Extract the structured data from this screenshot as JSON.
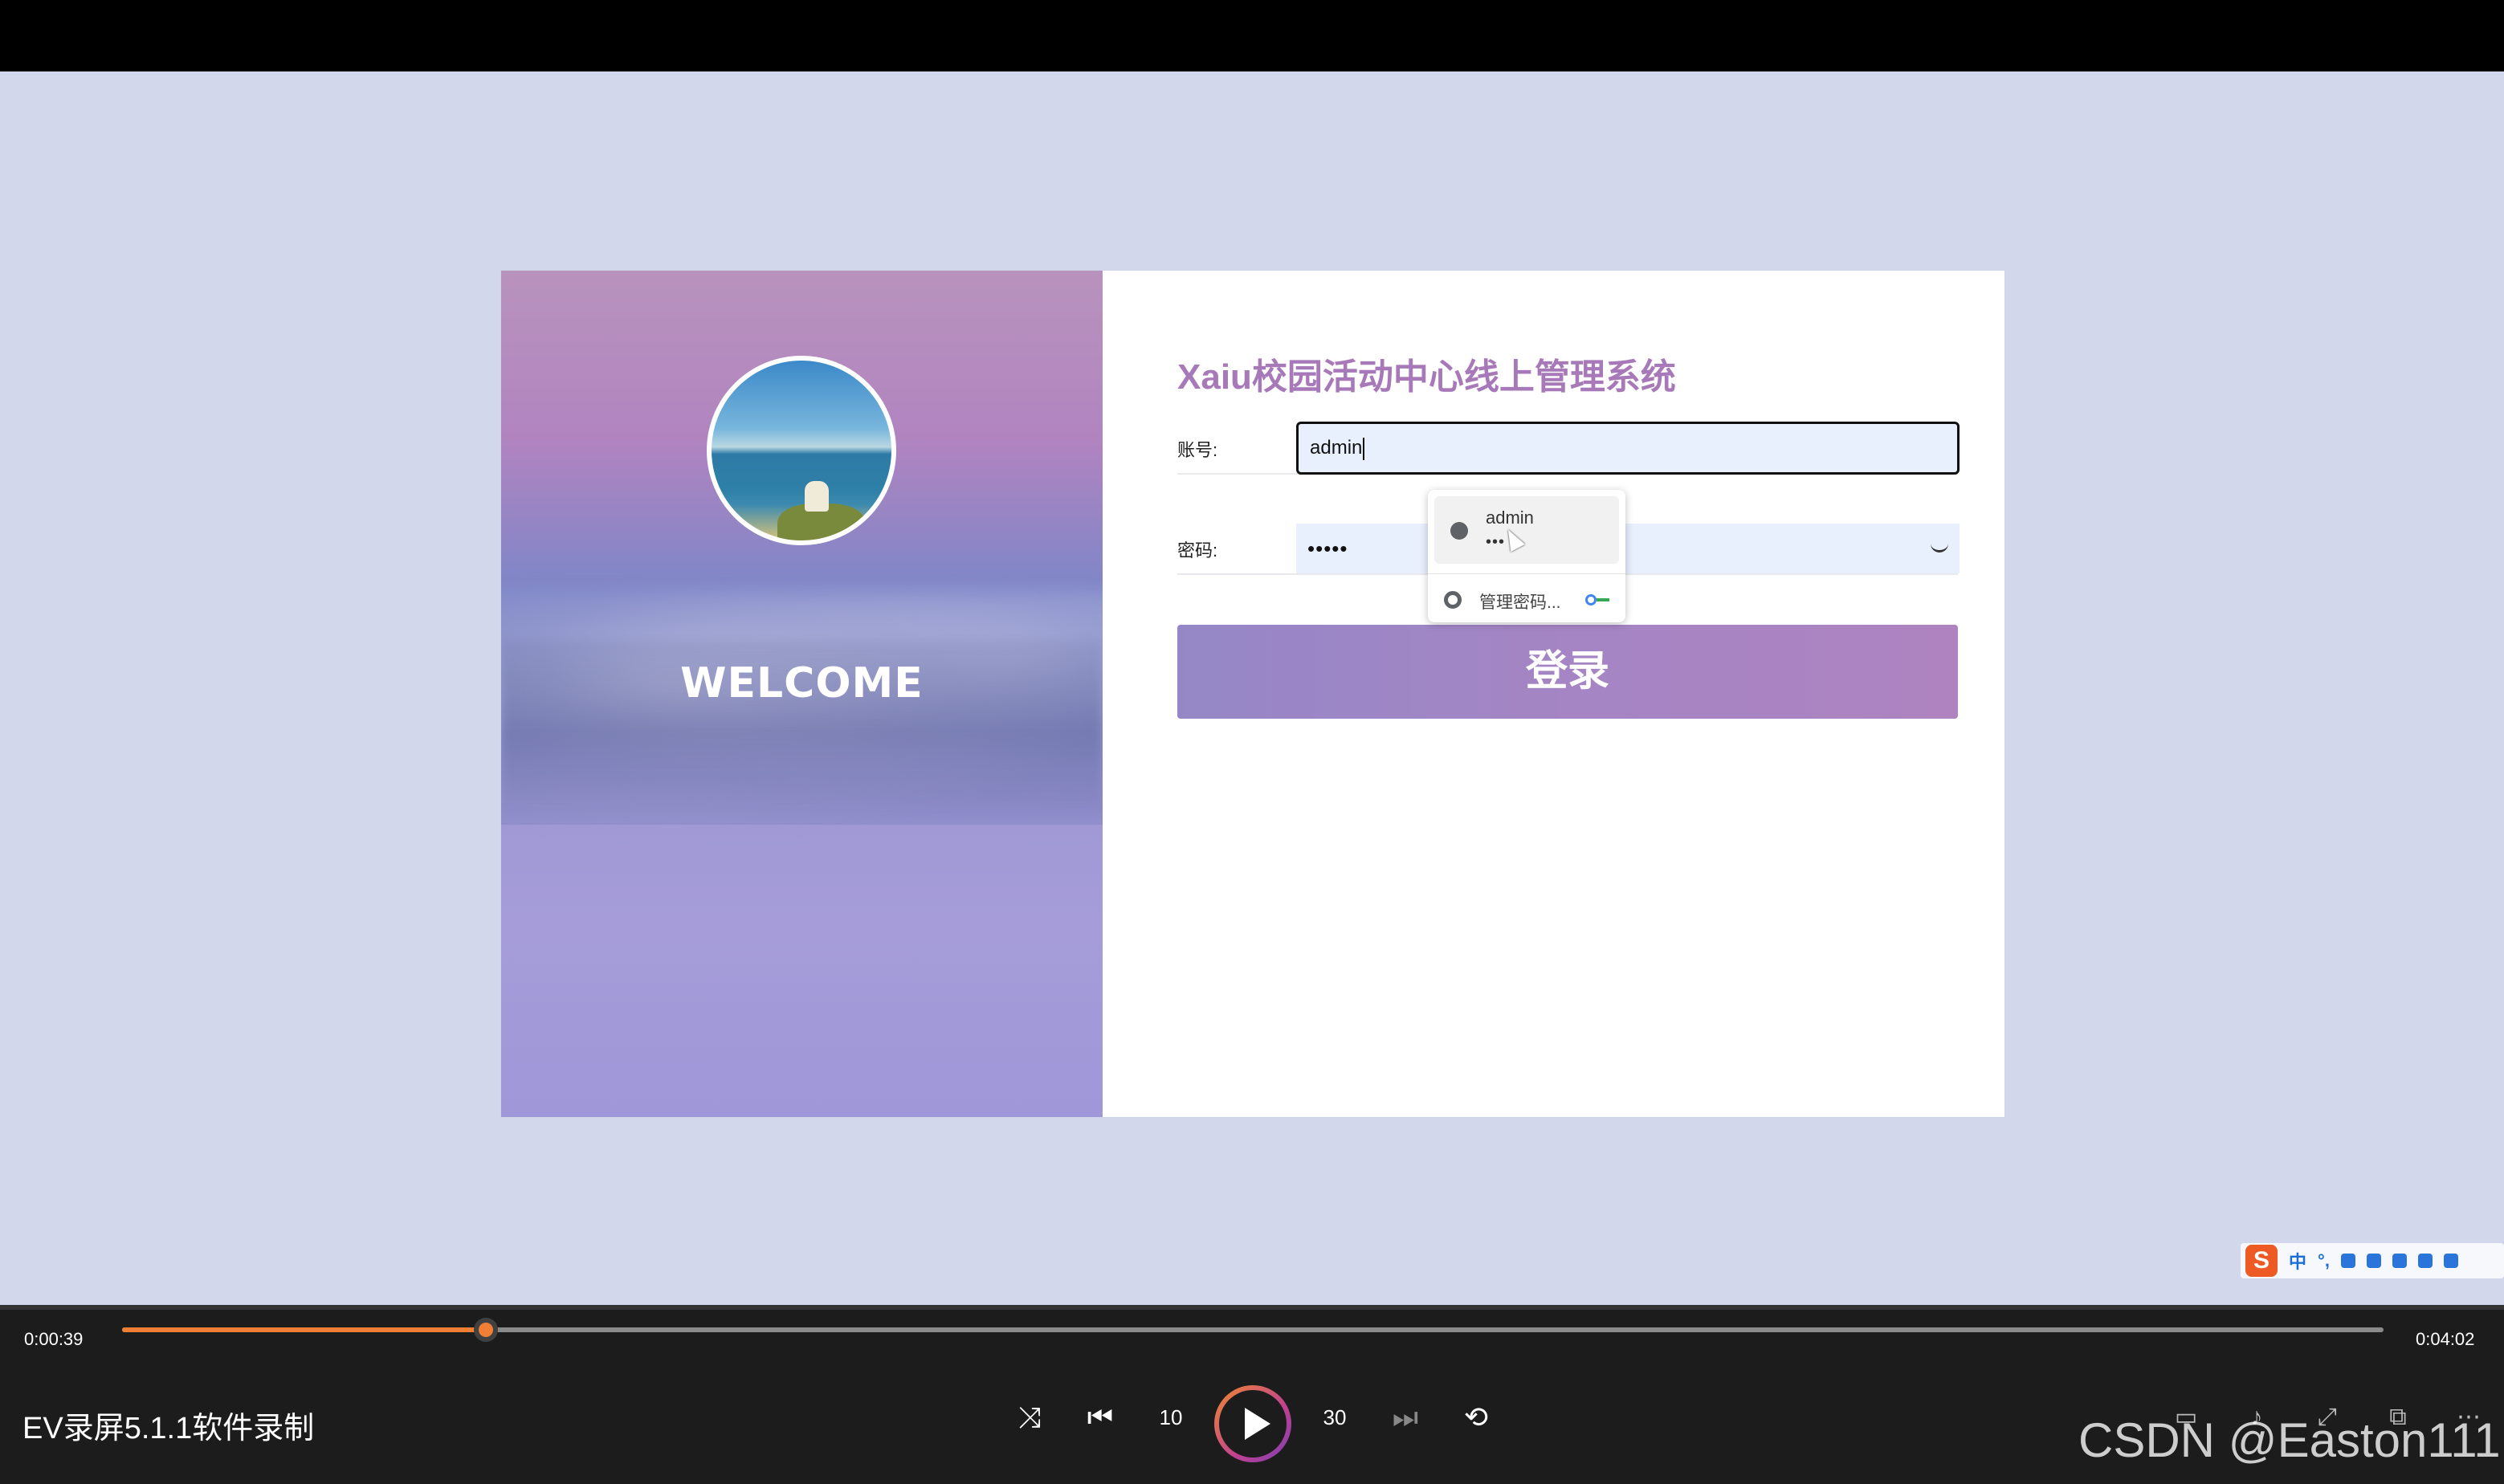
{
  "login": {
    "welcome": "WELCOME",
    "title": "Xaiu校园活动中心线上管理系统",
    "username_label": "账号:",
    "username_value": "admin",
    "password_label": "密码:",
    "password_value": "•••••",
    "login_button": "登录"
  },
  "autofill": {
    "saved_user": "admin",
    "saved_password_mask": "•••",
    "manage_label": "管理密码..."
  },
  "ime": {
    "lang": "中",
    "punct": "°,"
  },
  "player": {
    "current_time": "0:00:39",
    "total_time": "0:04:02",
    "progress_fraction": 0.161,
    "media_title": "EV录屏5.1.1软件录制",
    "rewind_label": "10",
    "forward_label": "30",
    "accent_color": "#f07f35"
  },
  "watermark": "CSDN @Easton111"
}
